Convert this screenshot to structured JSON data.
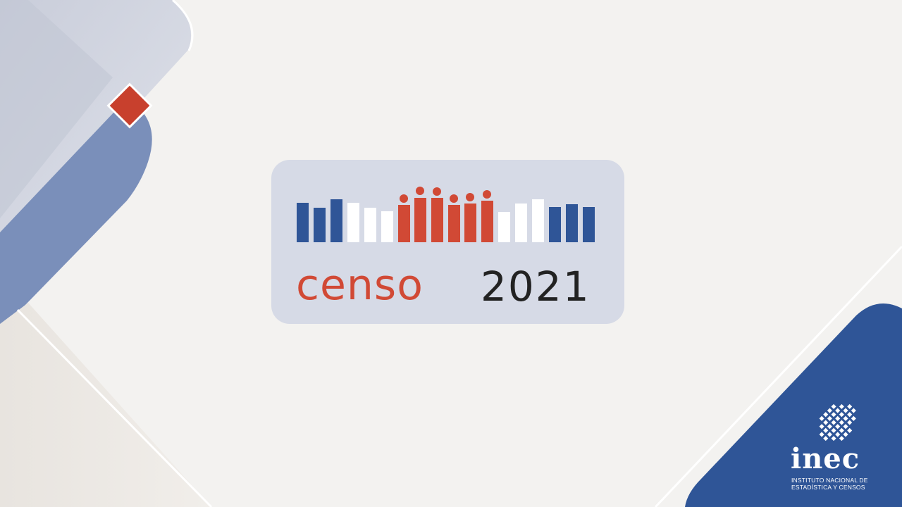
{
  "logo": {
    "word": "censo",
    "year": "2021"
  },
  "institution": {
    "acronym": "inec",
    "name_line1": "INSTITUTO NACIONAL DE",
    "name_line2": "ESTADÍSTICA Y CENSOS"
  },
  "colors": {
    "background": "#f3f2f0",
    "brand_blue": "#2f5597",
    "brand_red": "#d14935",
    "card": "#d6dae6",
    "text_dark": "#222222"
  },
  "icons": [
    "bar-graphic-icon",
    "people-figures-icon",
    "diamond-accent-icon",
    "inec-dot-grid-icon"
  ]
}
